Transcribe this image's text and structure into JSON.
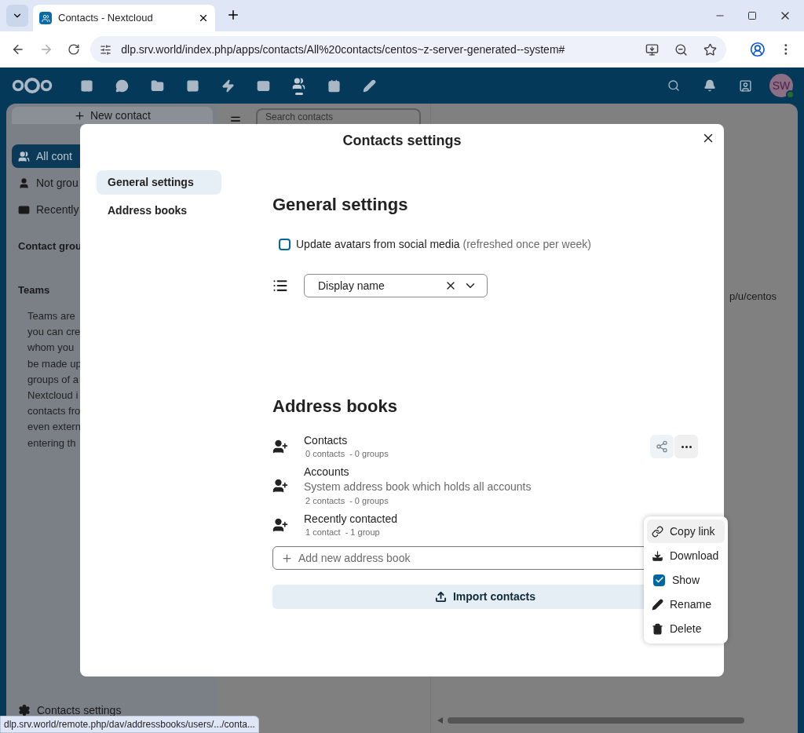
{
  "browser": {
    "tab_title": "Contacts - Nextcloud",
    "url": "dlp.srv.world/index.php/apps/contacts/All%20contacts/centos~z-server-generated--system#"
  },
  "header": {
    "apps": [
      {
        "kind": "dashboard",
        "selected": false
      },
      {
        "kind": "talk",
        "selected": false
      },
      {
        "kind": "files",
        "selected": false
      },
      {
        "kind": "photos",
        "selected": false
      },
      {
        "kind": "activity",
        "selected": false
      },
      {
        "kind": "mail",
        "selected": false
      },
      {
        "kind": "contacts",
        "selected": true
      },
      {
        "kind": "calendar",
        "selected": false
      },
      {
        "kind": "notes",
        "selected": false
      }
    ],
    "avatar": "SW"
  },
  "sidebar": {
    "new_contact": "New contact",
    "items": [
      {
        "kind": "all",
        "label": "All cont",
        "selected": true
      },
      {
        "kind": "ungrouped",
        "label": "Not grou",
        "selected": false
      },
      {
        "kind": "recent",
        "label": "Recently",
        "selected": false
      }
    ],
    "groups_heading": "Contact grou",
    "teams_heading": "Teams",
    "teams_text": [
      "Teams are",
      "you can cre",
      "whom you",
      "be made up",
      "groups of a",
      "Nextcloud i",
      "contacts fro",
      "even extern",
      "entering th"
    ],
    "settings": "Contacts settings"
  },
  "list": {
    "search_placeholder": "Search contacts"
  },
  "details": {
    "url_fragment": "p/u/centos"
  },
  "modal": {
    "title": "Contacts settings",
    "nav": [
      {
        "label": "General settings",
        "selected": true
      },
      {
        "label": "Address books",
        "selected": false
      }
    ],
    "general": {
      "heading": "General settings",
      "avatar_option": {
        "label": "Update avatars from social media",
        "hint": "(refreshed once per week)",
        "checked": false
      },
      "sort": {
        "value": "Display name"
      }
    },
    "address_books": {
      "heading": "Address books",
      "books": [
        {
          "name": "Contacts",
          "contacts": "0 contacts",
          "groups": "- 0 groups",
          "actions_shown": true
        },
        {
          "name": "Accounts",
          "description": "System address book which holds all accounts",
          "contacts": "2 contacts",
          "groups": "- 0 groups",
          "actions_shown": false
        },
        {
          "name": "Recently contacted",
          "contacts": "1 contact",
          "groups": "- 1 group",
          "actions_shown": false
        }
      ],
      "add_placeholder": "Add new address book",
      "import_button": "Import contacts",
      "menu": [
        {
          "kind": "link",
          "label": "Copy link",
          "selected": true
        },
        {
          "kind": "download",
          "label": "Download",
          "selected": false
        },
        {
          "kind": "checkbox",
          "label": "Show",
          "checked": true,
          "selected": false
        },
        {
          "kind": "rename",
          "label": "Rename",
          "selected": false
        },
        {
          "kind": "delete",
          "label": "Delete",
          "selected": false
        }
      ]
    }
  },
  "status_url": "dlp.srv.world/remote.php/dav/addressbooks/users/.../conta..."
}
